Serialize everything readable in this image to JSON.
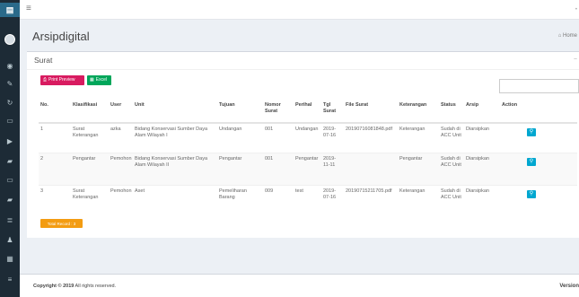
{
  "topbar": {
    "hamburger": "≡"
  },
  "page": {
    "title": "Arsipdigital",
    "breadcrumb_home": "Home"
  },
  "box": {
    "title": "Surat",
    "btn_print": "Print Preview",
    "btn_excel": "Excel"
  },
  "table": {
    "headers": [
      "No.",
      "Klasifikasi",
      "User",
      "Unit",
      "Tujuan",
      "Nomor Surat",
      "Perihal",
      "Tgl Surat",
      "File Surat",
      "Keterangan",
      "Status",
      "Arsip",
      "Action"
    ],
    "rows": [
      {
        "no": "1",
        "klasifikasi": "Surat Keterangan",
        "user": "azka",
        "unit": "Bidang Konservasi Sumber Daya Alam Wilayah I",
        "tujuan": "Undangan",
        "nomor": "001",
        "perihal": "Undangan",
        "tgl": "2019-07-16",
        "file": "20190716081848.pdf",
        "keterangan": "Keterangan",
        "status": "Sudah di ACC Unit",
        "arsip": "Diarsipkan"
      },
      {
        "no": "2",
        "klasifikasi": "Pengantar",
        "user": "Pemohon",
        "unit": "Bidang Konservasi Sumber Daya Alam Wilayah II",
        "tujuan": "Pengantar",
        "nomor": "001",
        "perihal": "Pengantar",
        "tgl": "2019-11-11",
        "file": "",
        "keterangan": "Pengantar",
        "status": "Sudah di ACC Unit",
        "arsip": "Diarsipkan"
      },
      {
        "no": "3",
        "klasifikasi": "Surat Keterangan",
        "user": "Pemohon",
        "unit": "Aset",
        "tujuan": "Pemeliharan Barang",
        "nomor": "009",
        "perihal": "test",
        "tgl": "2019-07-16",
        "file": "20190715211705.pdf",
        "keterangan": "Keterangan",
        "status": "Sudah di ACC Unit",
        "arsip": "Diarsipkan"
      }
    ]
  },
  "total_record": "Total Record : 3",
  "footer": {
    "copyright_bold": "Copyright © 2019",
    "copyright_rest": " All rights reserved.",
    "version": "Version"
  },
  "icons": [
    "logo-icon",
    "avatar",
    "dashboard-icon",
    "edit-icon",
    "history-icon",
    "inbox-icon",
    "send-icon",
    "archive-icon",
    "inbox-icon",
    "archive-icon",
    "list-icon",
    "user-icon",
    "database-icon",
    "menu-icon"
  ],
  "colors": {
    "sidebar": "#1d2b36",
    "print": "#d81b60",
    "excel": "#00a65a",
    "action": "#00a7d0",
    "badge": "#f39c12"
  }
}
